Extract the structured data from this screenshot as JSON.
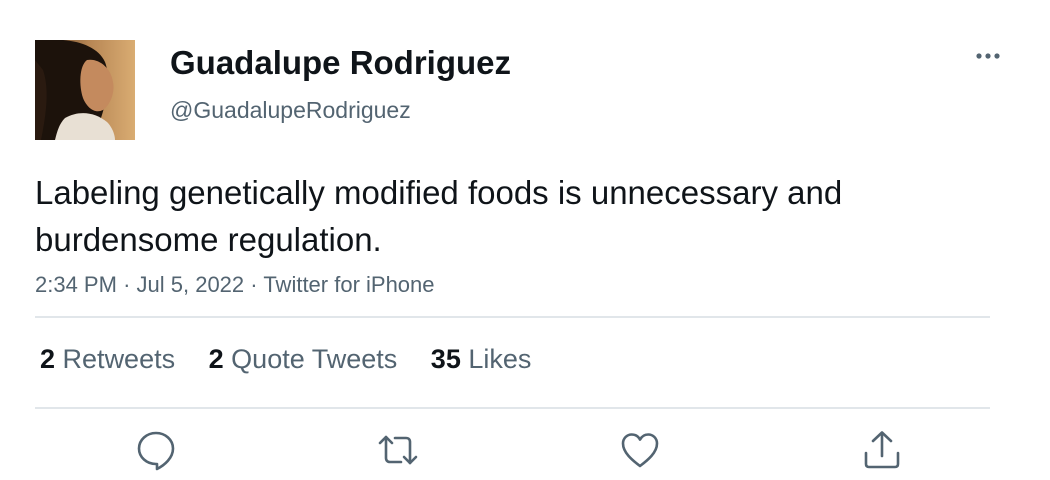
{
  "tweet": {
    "display_name": "Guadalupe Rodriguez",
    "handle": "@GuadalupeRodriguez",
    "text": "Labeling genetically modified foods is unnecessary and burdensome regulation.",
    "time": "2:34 PM",
    "date": "Jul 5, 2022",
    "source": "Twitter for iPhone",
    "separator": "·"
  },
  "stats": {
    "retweets_count": "2",
    "retweets_label": "Retweets",
    "quotes_count": "2",
    "quotes_label": "Quote Tweets",
    "likes_count": "35",
    "likes_label": "Likes"
  },
  "icons": {
    "more": "more-horizontal-icon",
    "reply": "reply-bubble-icon",
    "retweet": "retweet-arrows-icon",
    "like": "heart-icon",
    "share": "share-upload-icon"
  },
  "colors": {
    "text_primary": "#0f1419",
    "text_secondary": "#536471",
    "divider": "#e1e6ea",
    "icon": "#536471"
  }
}
